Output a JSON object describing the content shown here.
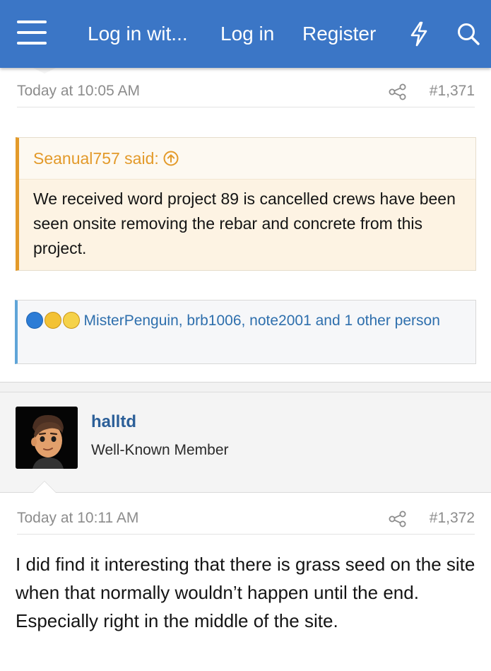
{
  "header": {
    "nav": {
      "login_with": "Log in wit...",
      "login": "Log in",
      "register": "Register"
    },
    "bg_color": "#3b76c6",
    "icons": [
      "menu-icon",
      "bolt-icon",
      "search-icon"
    ]
  },
  "post1": {
    "time": "Today at 10:05 AM",
    "number": "#1,371",
    "quote": {
      "author_line": "Seanual757 said:",
      "text": "We received word project 89 is cancelled crews have been seen onsite removing the rebar and concrete from this project.",
      "accent": "#e39a2a"
    },
    "reactions": {
      "users": "MisterPenguin, brb1006, note2001",
      "and_others": " and 1 other person",
      "icons": [
        "like-icon",
        "haha-icon",
        "wow-icon"
      ]
    }
  },
  "post2": {
    "user": {
      "name": "halltd",
      "title": "Well-Known Member"
    },
    "time": "Today at 10:11 AM",
    "number": "#1,372",
    "body": "I did find it interesting that there is grass seed on the site when that normally wouldn’t happen until the end. Especially right in the middle of the site."
  }
}
